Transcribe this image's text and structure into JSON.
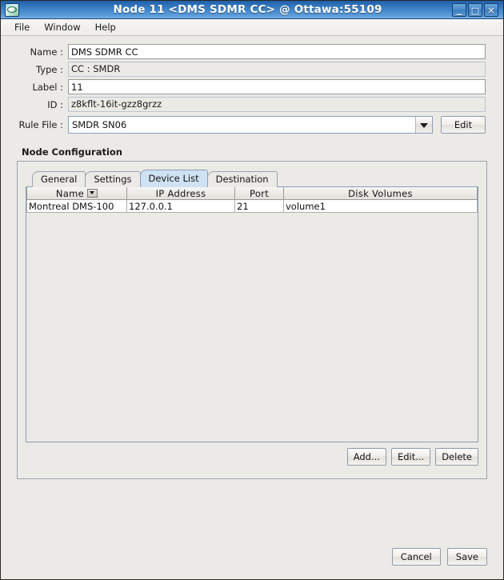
{
  "window": {
    "title": "Node 11 <DMS SDMR CC> @ Ottawa:55109",
    "icon": "app-window-icon",
    "minimize_label": "_",
    "maximize_label": "□",
    "close_label": "✕"
  },
  "menubar": {
    "items": [
      {
        "label": "File"
      },
      {
        "label": "Window"
      },
      {
        "label": "Help"
      }
    ]
  },
  "form": {
    "fields": [
      {
        "label": "Name :",
        "value": "DMS SDMR CC",
        "readonly": false
      },
      {
        "label": "Type :",
        "value": "CC : SMDR",
        "readonly": true
      },
      {
        "label": "Label :",
        "value": "11",
        "readonly": false
      },
      {
        "label": "ID :",
        "value": "z8kflt-16it-gzz8grzz",
        "readonly": true
      }
    ],
    "rule_file": {
      "label": "Rule File :",
      "value": "SMDR SN06",
      "arrow_icon": "chevron-down-icon",
      "edit_label": "Edit"
    }
  },
  "node_configuration": {
    "title": "Node  Configuration",
    "tabs": [
      {
        "label": "General",
        "active": false
      },
      {
        "label": "Settings",
        "active": false
      },
      {
        "label": "Device List",
        "active": true
      },
      {
        "label": "Destination",
        "active": false
      }
    ],
    "table": {
      "columns": [
        {
          "label": "Name",
          "sort_icon": "sort-descending-icon"
        },
        {
          "label": "IP Address"
        },
        {
          "label": "Port"
        },
        {
          "label": "Disk Volumes"
        }
      ],
      "rows": [
        {
          "name": "Montreal DMS-100",
          "ip": "127.0.0.1",
          "port": "21",
          "volumes": "volume1"
        }
      ]
    },
    "actions": [
      {
        "label": "Add..."
      },
      {
        "label": "Edit..."
      },
      {
        "label": "Delete"
      }
    ]
  },
  "footer": {
    "cancel_label": "Cancel",
    "save_label": "Save"
  },
  "colors": {
    "titlebar_blue": "#3f7ec1",
    "panel_bg": "#eceae6",
    "active_tab": "#cfe2f3",
    "field_border": "#9a9a9a"
  }
}
